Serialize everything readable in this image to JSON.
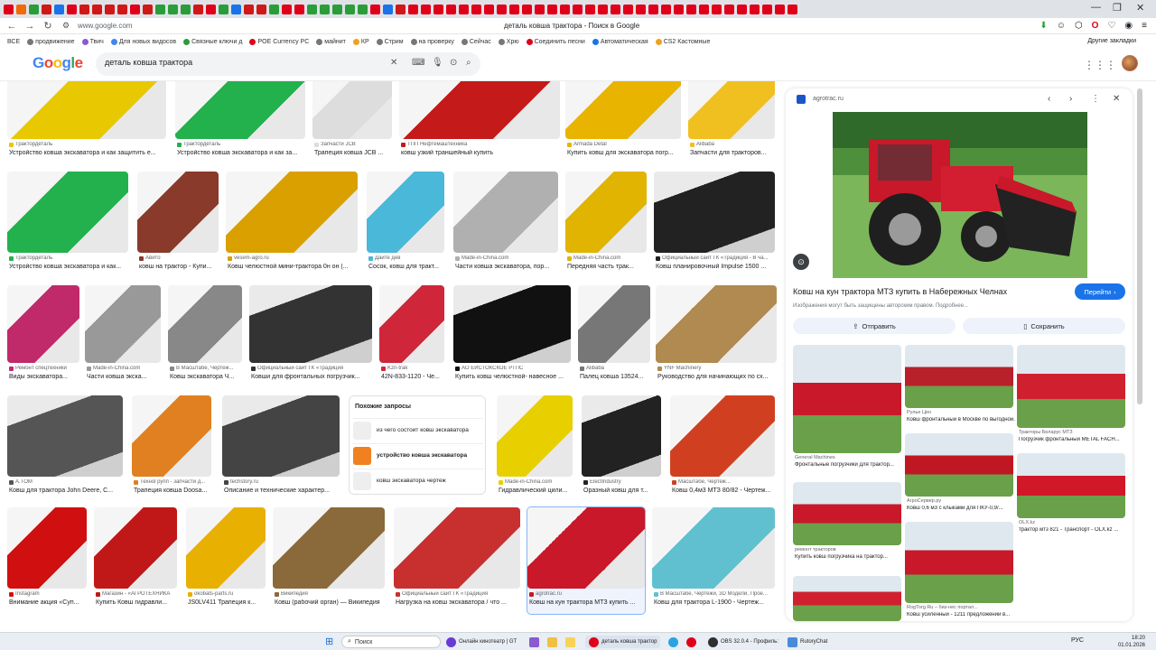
{
  "browser": {
    "url": "www.google.com",
    "page_title": "деталь ковша трактора - Поиск в Google"
  },
  "bookmarks": {
    "items": [
      "ВСЕ",
      "продвижение",
      "Твич",
      "Для новых видосов",
      "Связные ключи д",
      "POE Currency PC",
      "майнит",
      "КР",
      "Стрим",
      "на проверку",
      "Сейчас",
      "Хрю",
      "Соединить песни",
      "Автоматическая",
      "CS2 Кастомные"
    ],
    "other": "Другие закладки"
  },
  "search": {
    "query": "деталь ковша трактора",
    "logo": "Google"
  },
  "results": [
    {
      "src": "Трактордеталь",
      "cap": "Устройство ковша экскаватора и как защитить е...",
      "color": "#e8c800"
    },
    {
      "src": "Трактордеталь",
      "cap": "Устройство ковша экскаватора и как за...",
      "color": "#23b14d"
    },
    {
      "src": "Запчасти JCB",
      "cap": "Трапеция ковша JCB ...",
      "color": "#dddddd"
    },
    {
      "src": "ТПП Нефтемаштехника",
      "cap": "ковш узкий траншейный купить",
      "color": "#c41a1a"
    },
    {
      "src": "Armada Detal",
      "cap": "Купить ковш для экскаватора погр...",
      "color": "#e8b400"
    },
    {
      "src": "Alibaba",
      "cap": "Запчасти для тракторов...",
      "color": "#f0c020"
    },
    {
      "src": "Трактордеталь",
      "cap": "Устройство ковша экскаватора и как...",
      "color": "#23b14d"
    },
    {
      "src": "Авито",
      "cap": "ковш на трактор - Купи...",
      "color": "#8a3a2a"
    },
    {
      "src": "vesem-agro.ru",
      "cap": "Ковш челюстной мини-трактора 0н он (...",
      "color": "#d9a000"
    },
    {
      "src": "Дайте дев",
      "cap": "Сосок, ковш для тракт...",
      "color": "#4ab8d8"
    },
    {
      "src": "Made-in-China.com",
      "cap": "Части ковша экскаватора, пор...",
      "color": "#b0b0b0"
    },
    {
      "src": "Made-in-China.com",
      "cap": "Передняя часть трак...",
      "color": "#e0b400"
    },
    {
      "src": "Официальный сайт ГК «Традиция - В ча...",
      "cap": "Ковш планировочный Impulse 1500 ...",
      "color": "#222222"
    },
    {
      "src": "Ремонт спецтехники",
      "cap": "Виды экскаватора...",
      "color": "#c02a6a"
    },
    {
      "src": "Made-in-China.com",
      "cap": "Части ковша экска...",
      "color": "#999999"
    },
    {
      "src": "В Масштабе, Чертеж...",
      "cap": "Ковш экскаватора Ч...",
      "color": "#888888"
    },
    {
      "src": "Официальный сайт ГК «Традиция",
      "cap": "Ковши для фронтальных погрузчик...",
      "color": "#333333"
    },
    {
      "src": "Kzn-trak",
      "cap": "42N-833-1120 - Че...",
      "color": "#d0263a"
    },
    {
      "src": "АО ЕИСТОКСКОЕ РТПС",
      "cap": "Купить ковш челюстной- навесное ...",
      "color": "#111111"
    },
    {
      "src": "Alibaba",
      "cap": "Палец ковша 13524...",
      "color": "#777777"
    },
    {
      "src": "YNF Machinery",
      "cap": "Руководство для начинающих по сх...",
      "color": "#b08a50"
    },
    {
      "src": "A.TOM",
      "cap": "Ковш для трактора John Deere, C...",
      "color": "#555555"
    },
    {
      "src": "ТехноГрупп - запчасти д...",
      "cap": "Трапеция ковша Doosa...",
      "color": "#e08020"
    },
    {
      "src": "techstory.ru",
      "cap": "Описание и технические характер...",
      "color": "#444444"
    },
    {
      "src": "Made-in-China.com",
      "cap": "Гидравлический цили...",
      "color": "#e8d000"
    },
    {
      "src": "ElectIndustry",
      "cap": "Оразный ковш для т...",
      "color": "#222222"
    },
    {
      "src": "Масштабе, Чертеж...",
      "cap": "Ковш 0,4м3 МТЗ 80/82 - Чертеж...",
      "color": "#d04020"
    },
    {
      "src": "Instagram",
      "cap": "Внимание акция «Суп...",
      "color": "#d01010"
    },
    {
      "src": "Магазин - «АГРОТЕХНИКА",
      "cap": "Купить Ковш гидравли...",
      "color": "#c01818"
    },
    {
      "src": "okobats-parts.ru",
      "cap": "JS0LV411 Трапеция к...",
      "color": "#e8b000"
    },
    {
      "src": "Википедия",
      "cap": "Ковш (рабочий орган) — Википедия",
      "color": "#8a6a3a"
    },
    {
      "src": "Официальный сайт ГК «Традиция",
      "cap": "Нагрузка на ковш экскаватора / что ...",
      "color": "#c83030"
    },
    {
      "src": "agrotrac.ru",
      "cap": "Ковш на кун трактора МТЗ купить ...",
      "color": "#c8182a"
    },
    {
      "src": "В Масштабе, Чертежи, 3D Модели, Прое...",
      "cap": "Ковш для трактора L-1900 - Чертеж...",
      "color": "#60c0d0"
    }
  ],
  "related": {
    "title": "Похожие запросы",
    "items": [
      {
        "text": "из чего состоит ковш экскаватора"
      },
      {
        "text": "устройство ковша экскаватора"
      },
      {
        "text": "ковш экскаватора чертеж"
      }
    ]
  },
  "panel": {
    "site": "agrotrac.ru",
    "title": "Ковш на кун трактора МТЗ купить в Набережных Челнах",
    "note": "Изображения могут быть защищены авторским правом. Подробнее...",
    "visit": "Перейти",
    "share": "Отправить",
    "save": "Сохранить",
    "similar": [
      {
        "src": "General Machines",
        "cap": "Фронтальные погрузчики для трактор..."
      },
      {
        "src": "Рулье Цен",
        "cap": "Ковш фронтальный в Москве по выгодной..."
      },
      {
        "src": "Тракторы Беларус МТЗ",
        "cap": "Погрузчик фронтальный METAL FACH..."
      },
      {
        "src": "АгроСервер.ру",
        "cap": "Ковш 0,6 м3 с клыками для ПКУ-0,9/..."
      },
      {
        "src": "ремонт тракторов",
        "cap": "Купить ковш погрузчика на трактор..."
      },
      {
        "src": "OLX.kz",
        "cap": "трактор мтз 821 - Транспорт - OLX.kz ..."
      },
      {
        "src": "RogTorg.Ru – биз-нес портал...",
        "cap": "Ковш усиленный - 1211 предложений в..."
      },
      {
        "src": "",
        "cap": ""
      }
    ]
  },
  "taskbar": {
    "search": "Поиск",
    "items": [
      "Онлайн кинотеатр | GT",
      "деталь ковша трактор",
      "OBS 32.0.4 - Профиль:",
      "RutoryChat"
    ],
    "lang": "РУС",
    "time": "18:20",
    "date": "01.01.2026"
  },
  "colors": {
    "accent": "#1a73e8",
    "tractor_red": "#c8182a",
    "grass": "#5aa83a"
  }
}
